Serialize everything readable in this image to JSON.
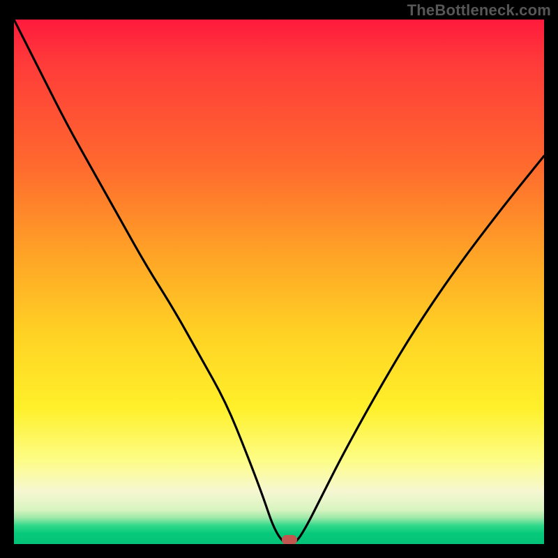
{
  "watermark": "TheBottleneck.com",
  "chart_data": {
    "type": "line",
    "title": "",
    "xlabel": "",
    "ylabel": "",
    "xlim": [
      0,
      100
    ],
    "ylim": [
      0,
      100
    ],
    "grid": false,
    "legend": false,
    "background_gradient": [
      "#ff1a3c",
      "#ff6a2e",
      "#ffd224",
      "#fdfd86",
      "#06c97b"
    ],
    "series": [
      {
        "name": "bottleneck-curve",
        "color": "#000000",
        "x": [
          0,
          5,
          10,
          15,
          20,
          25,
          30,
          35,
          40,
          44,
          47,
          49,
          51,
          53,
          55,
          58,
          62,
          68,
          75,
          83,
          92,
          100
        ],
        "y": [
          100,
          90,
          80,
          71,
          62,
          53,
          45,
          36,
          27,
          17,
          9,
          3,
          0,
          0,
          3,
          9,
          17,
          28,
          40,
          52,
          64,
          74
        ]
      }
    ],
    "marker": {
      "x": 52,
      "y": 0.8,
      "color": "#c1574f"
    }
  }
}
